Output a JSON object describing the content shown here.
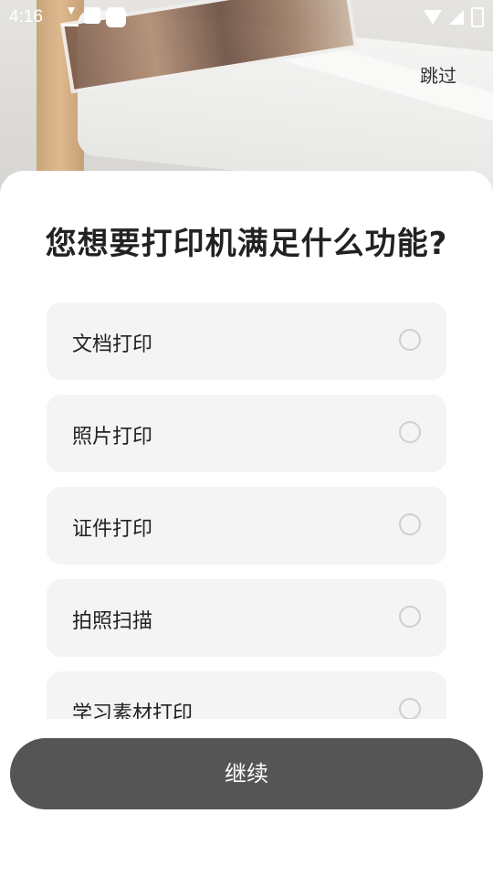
{
  "status_bar": {
    "time": "4:16",
    "icons_left": [
      "download-icon",
      "image-icon",
      "dot-icon"
    ],
    "icons_right": [
      "wifi-icon",
      "signal-icon",
      "battery-icon"
    ]
  },
  "header": {
    "skip_label": "跳过"
  },
  "sheet": {
    "title": "您想要打印机满足什么功能?",
    "options": [
      {
        "label": "文档打印",
        "selected": false
      },
      {
        "label": "照片打印",
        "selected": false
      },
      {
        "label": "证件打印",
        "selected": false
      },
      {
        "label": "拍照扫描",
        "selected": false
      },
      {
        "label": "学习素材打印",
        "selected": false
      }
    ]
  },
  "footer": {
    "continue_label": "继续"
  },
  "colors": {
    "button_bg": "#555555",
    "option_bg": "#f4f4f4",
    "title": "#222222"
  }
}
